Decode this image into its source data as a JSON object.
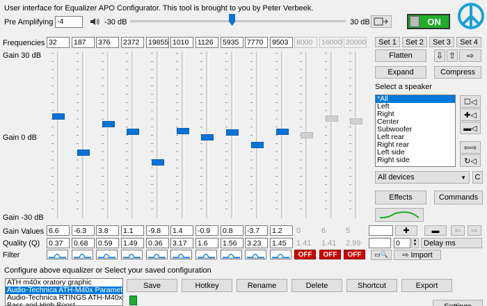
{
  "header": {
    "info": "User interface for Equalizer APO Configurator. This tool is brought to you by Peter Verbeek.",
    "pre_amp_label": "Pre Amplifying",
    "pre_amp_value": "-4",
    "pre_amp_min": "-30 dB",
    "pre_amp_max": "30 dB",
    "power_label": "ON",
    "pre_amp_level": 0.473
  },
  "labels": {
    "frequencies": "Frequencies",
    "gain_top": "Gain 30 dB",
    "gain_mid": "Gain 0 dB",
    "gain_bottom": "Gain -30 dB",
    "gain_values": "Gain Values",
    "quality": "Quality (Q)",
    "filter": "Filter",
    "select_speaker": "Select a speaker",
    "configure": "Configure above equalizer or Select your saved configuration"
  },
  "bands": {
    "frequencies": [
      "32",
      "187",
      "376",
      "2372",
      "19855",
      "1010",
      "1126",
      "5935",
      "7770",
      "9503",
      "8000",
      "16000",
      "20000"
    ],
    "gains": [
      "6.6",
      "-6.3",
      "3.8",
      "1.1",
      "-9.8",
      "1.4",
      "-0.9",
      "0.8",
      "-3.7",
      "1.2",
      "0",
      "6",
      "5"
    ],
    "qualities": [
      "0.37",
      "0.68",
      "0.59",
      "1.49",
      "0.36",
      "3.17",
      "1.6",
      "1.56",
      "3.23",
      "1.45",
      "1.41",
      "1.41",
      "2.99"
    ],
    "filter_off_label": "OFF"
  },
  "sets": [
    "Set 1",
    "Set 2",
    "Set 3",
    "Set 4"
  ],
  "buttons": {
    "flatten": "Flatten",
    "expand": "Expand",
    "compress": "Compress",
    "effects": "Effects",
    "commands": "Commands",
    "import": "Import",
    "delay": "Delay ms",
    "delay_value": "0",
    "save": "Save",
    "hotkey": "Hotkey",
    "rename": "Rename",
    "delete": "Delete",
    "shortcut": "Shortcut",
    "export": "Export",
    "settings": "Settings",
    "c": "C"
  },
  "speakers": [
    "*All",
    "Left",
    "Right",
    "Center",
    "Subwoofer",
    "Left rear",
    "Right rear",
    "Left side",
    "Right side"
  ],
  "device": "All devices",
  "configs": [
    "ATH m40x oratory graphic",
    "Audio-Technica ATH-M40x Parametric",
    "Audio-Technica RTINGS ATH-M40x",
    "Bass and High Boost"
  ],
  "colors": {
    "accent": "#0a72d6",
    "off": "#cc0000",
    "power_on": "#1fae2b"
  }
}
